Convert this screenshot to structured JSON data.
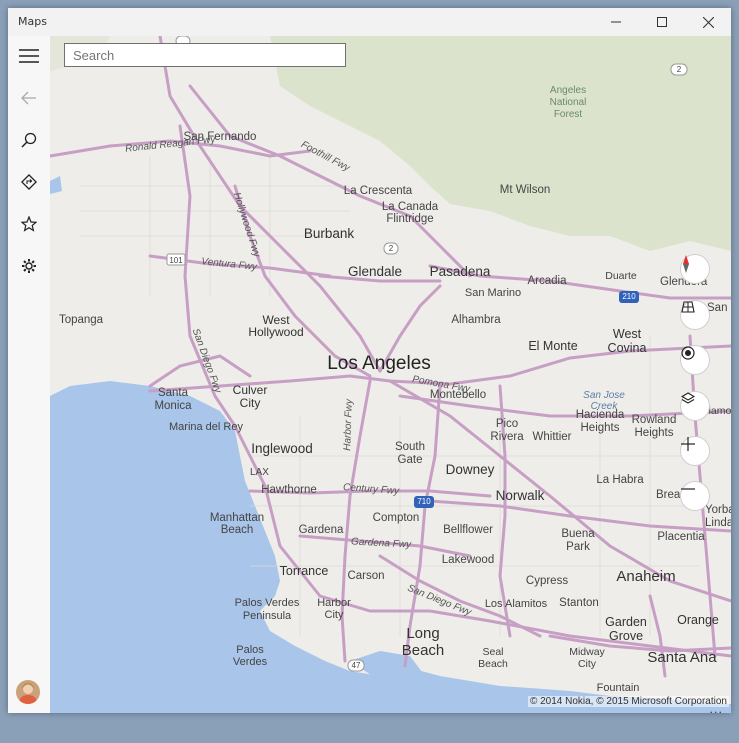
{
  "window": {
    "title": "Maps"
  },
  "search": {
    "placeholder": "Search"
  },
  "sidebar": {
    "items": [
      "menu",
      "back",
      "search",
      "directions",
      "favorites",
      "settings"
    ]
  },
  "icons": {
    "menu": "hamburger-icon",
    "back": "back-arrow-icon",
    "search": "search-icon",
    "directions": "directions-icon",
    "favorites": "star-icon",
    "settings": "gear-icon",
    "compass": "compass-icon",
    "streetside": "streetside-icon",
    "location": "location-icon",
    "layers": "layers-icon",
    "zoom_in": "plus-icon",
    "zoom_out": "minus-icon"
  },
  "colors": {
    "land": "#eeede9",
    "forest": "#d9e2c9",
    "water": "#a8c4e8",
    "road": "#c69ec2",
    "accent": "#e03030"
  },
  "map": {
    "cities_large": [
      "Los Angeles",
      "Anaheim",
      "Santa Ana"
    ],
    "cities_long_beach": [
      "Long",
      "Beach"
    ],
    "cities_medium": [
      "Burbank",
      "Glendale",
      "Pasadena",
      "West",
      "Hollywood",
      "Culver",
      "City",
      "Inglewood",
      "El Monte",
      "West",
      "Covina",
      "Downey",
      "Norwalk",
      "Torrance",
      "Garden",
      "Grove",
      "Orange"
    ],
    "cities_small": [
      "San Fernando",
      "La Crescenta",
      "La Canada",
      "Flintridge",
      "Mt Wilson",
      "Arcadia",
      "Duarte",
      "Glendora",
      "San Marino",
      "Alhambra",
      "Topanga",
      "Santa",
      "Monica",
      "Marina del Rey",
      "Montebello",
      "Pico",
      "Rivera",
      "Whittier",
      "Hacienda",
      "Heights",
      "Rowland",
      "Heights",
      "South",
      "Gate",
      "La Habra",
      "Brea",
      "Hawthorne",
      "Manhattan",
      "Beach",
      "Gardena",
      "Compton",
      "Bellflower",
      "Lakewood",
      "Buena",
      "Park",
      "Placentia",
      "Yorba",
      "Linda",
      "Carson",
      "Cypress",
      "Palos Verdes",
      "Peninsula",
      "Harbor",
      "City",
      "Los Alamitos",
      "Stanton",
      "Palos",
      "Verdes",
      "Seal",
      "Beach",
      "Midway",
      "City",
      "Fountain",
      "Valley",
      "San Di",
      "Diamond Bar"
    ],
    "roads": [
      "Ronald Reagan Fwy",
      "Foothill Fwy",
      "Hollywood Fwy",
      "Ventura Fwy",
      "San Diego Fwy",
      "Pomona Fwy",
      "Harbor Fwy",
      "Century Fwy",
      "Gardena Fwy",
      "San Diego Fwy"
    ],
    "shields": [
      "2",
      "2",
      "101",
      "210",
      "710",
      "47"
    ],
    "water_labels": [
      "San Jose",
      "Creek"
    ],
    "forest_labels": [
      "Angeles",
      "National",
      "Forest"
    ],
    "airport": "LAX"
  },
  "copyright": "© 2014 Nokia, © 2015 Microsoft Corporation",
  "bottom_more": "..."
}
